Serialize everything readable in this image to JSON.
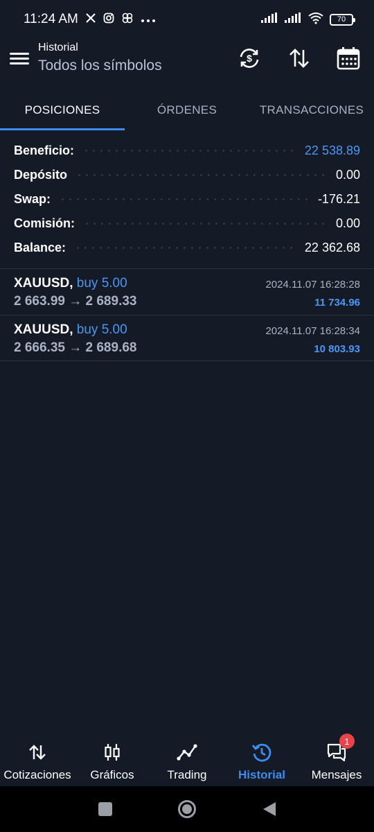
{
  "status_bar": {
    "time": "11:24 AM",
    "notification_icons": [
      "x-icon",
      "instagram-icon",
      "pinwheel-icon",
      "more-icon"
    ],
    "battery": "70"
  },
  "header": {
    "subtitle": "Historial",
    "title": "Todos los símbolos",
    "icons": [
      "currency-exchange-icon",
      "sort-icon",
      "calendar-icon"
    ]
  },
  "tabs": [
    {
      "label": "POSICIONES",
      "active": true
    },
    {
      "label": "ÓRDENES",
      "active": false
    },
    {
      "label": "TRANSACCIONES",
      "active": false
    }
  ],
  "summary": [
    {
      "label": "Beneficio:",
      "value": "22 538.89",
      "accent": true
    },
    {
      "label": "Depósito",
      "value": "0.00",
      "accent": false
    },
    {
      "label": "Swap:",
      "value": "-176.21",
      "accent": false
    },
    {
      "label": "Comisión:",
      "value": "0.00",
      "accent": false
    },
    {
      "label": "Balance:",
      "value": "22 362.68",
      "accent": false
    }
  ],
  "positions": [
    {
      "symbol": "XAUUSD,",
      "side": "buy 5.00",
      "prices": "2 663.99 → 2 689.33",
      "time": "2024.11.07 16:28:28",
      "profit": "11 734.96"
    },
    {
      "symbol": "XAUUSD,",
      "side": "buy 5.00",
      "prices": "2 666.35 → 2 689.68",
      "time": "2024.11.07 16:28:34",
      "profit": "10 803.93"
    }
  ],
  "bottom_nav": [
    {
      "label": "Cotizaciones",
      "icon": "quotes-arrows-icon",
      "active": false
    },
    {
      "label": "Gráficos",
      "icon": "candlestick-icon",
      "active": false
    },
    {
      "label": "Trading",
      "icon": "trading-line-icon",
      "active": false
    },
    {
      "label": "Historial",
      "icon": "history-clock-icon",
      "active": true
    },
    {
      "label": "Mensajes",
      "icon": "messages-icon",
      "active": false,
      "badge": "1"
    }
  ],
  "colors": {
    "background": "#141b26",
    "accent": "#3e8cf2",
    "badge": "#e5454a"
  }
}
